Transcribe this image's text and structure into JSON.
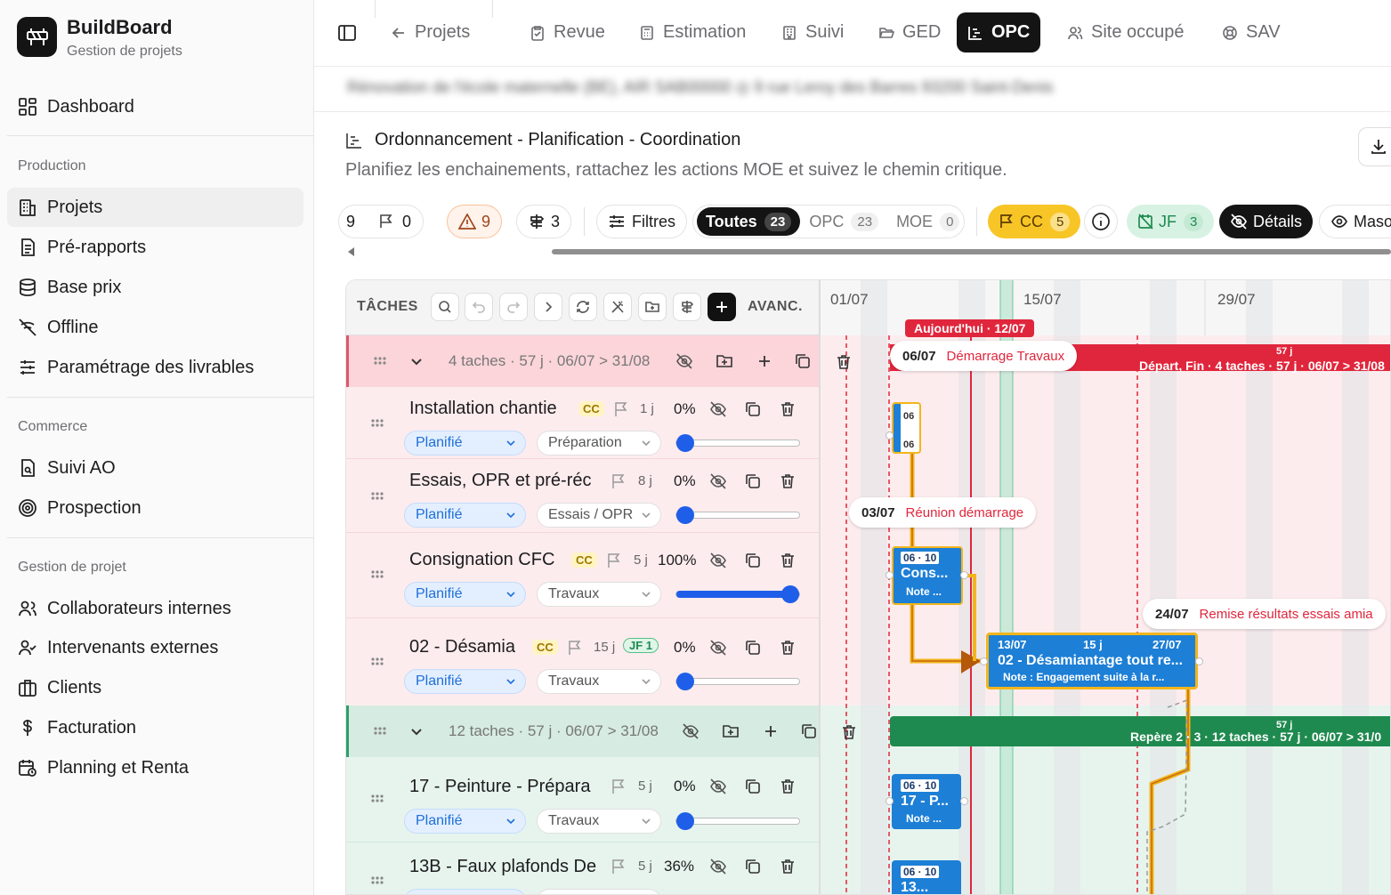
{
  "app": {
    "name": "BuildBoard",
    "subtitle": "Gestion de projets"
  },
  "sidebar": {
    "dashboard": "Dashboard",
    "sections": {
      "production": "Production",
      "commerce": "Commerce",
      "gestion": "Gestion de projet"
    },
    "items": {
      "projets": "Projets",
      "prerapports": "Pré-rapports",
      "baseprix": "Base prix",
      "offline": "Offline",
      "livrables": "Paramétrage des livrables",
      "suiviao": "Suivi AO",
      "prospection": "Prospection",
      "collab": "Collaborateurs internes",
      "intervenants": "Intervenants externes",
      "clients": "Clients",
      "facturation": "Facturation",
      "planning": "Planning et Renta"
    }
  },
  "tabs": {
    "projets": "Projets",
    "revue": "Revue",
    "estimation": "Estimation",
    "suivi": "Suivi",
    "ged": "GED",
    "opc": "OPC",
    "siteoccupe": "Site occupé",
    "sav": "SAV"
  },
  "project_blurred": "Rénovation de l'école maternelle (BE), AIR   SAB00000   ◎ 9 rue Leroy des Barres 93200 Saint-Denis",
  "section": {
    "title": "Ordonnancement - Planification - Coordination",
    "subtitle": "Planifiez les enchainements, rattachez les actions MOE et suivez le chemin critique."
  },
  "toolbar": {
    "count_partial": "9",
    "flags": "0",
    "warnings": "9",
    "signposts": "3",
    "filtres": "Filtres",
    "toutes": "Toutes",
    "toutes_count": "23",
    "opc": "OPC",
    "opc_count": "23",
    "moe": "MOE",
    "moe_count": "0",
    "cc": "CC",
    "cc_count": "5",
    "jf": "JF",
    "jf_count": "3",
    "details": "Détails",
    "masquer": "Maso"
  },
  "grid": {
    "col_taches": "TÂCHES",
    "col_avanc": "AVANC.",
    "dates": [
      "01/07",
      "15/07",
      "29/07"
    ]
  },
  "groups": [
    {
      "info": "4 taches · 57 j · 06/07 > 31/08",
      "bar_label": "Départ, Fin · 4 taches · 57 j · 06/07 > 31/08",
      "bar_dur": "57 j"
    },
    {
      "info": "12 taches · 57 j · 06/07 > 31/08",
      "bar_label": "Repère 2 · 3 · 12 taches · 57 j · 06/07 > 31/0",
      "bar_dur": "57 j"
    }
  ],
  "tasks": [
    {
      "name": "Installation chantie",
      "cc": "CC",
      "duration": "1 j",
      "progress_text": "0%",
      "progress": 0,
      "status": "Planifié",
      "phase": "Préparation"
    },
    {
      "name": "Essais, OPR et pré-réc",
      "duration": "8 j",
      "progress_text": "0%",
      "progress": 0,
      "status": "Planifié",
      "phase": "Essais / OPR"
    },
    {
      "name": "Consignation CFC",
      "cc": "CC",
      "duration": "5 j",
      "progress_text": "100%",
      "progress": 100,
      "status": "Planifié",
      "phase": "Travaux"
    },
    {
      "name": "02 - Désamia",
      "cc": "CC",
      "duration": "15 j",
      "jf": "JF 1",
      "progress_text": "0%",
      "progress": 0,
      "status": "Planifié",
      "phase": "Travaux"
    },
    {
      "name": "17 - Peinture - Prépara",
      "duration": "5 j",
      "progress_text": "0%",
      "progress": 0,
      "status": "Planifié",
      "phase": "Travaux"
    },
    {
      "name": "13B - Faux plafonds De",
      "duration": "5 j",
      "progress_text": "36%",
      "progress": 36
    }
  ],
  "gantt": {
    "today": "Aujourd'hui · 12/07",
    "milestones": [
      {
        "date": "06/07",
        "text": "Démarrage Travaux"
      },
      {
        "date": "03/07",
        "text": "Réunion démarrage"
      },
      {
        "date": "24/07",
        "text": "Remise résultats essais amia"
      }
    ],
    "bars": {
      "install": {
        "d1": "06",
        "d2": "06"
      },
      "cons": {
        "dates": "06 · 10",
        "name": "Cons...",
        "note": "Note ..."
      },
      "desam": {
        "start": "13/07",
        "dur": "15 j",
        "end": "27/07",
        "name": "02 - Désamiantage tout re...",
        "note": "Note : Engagement suite à la r..."
      },
      "peint": {
        "dates": "06 · 10",
        "name": "17 - P...",
        "note": "Note ..."
      },
      "fp": {
        "dates": "06 · 10",
        "name": "13..."
      }
    }
  },
  "colors": {
    "accent": "#141414",
    "critical": "#e0263c",
    "task_blue": "#1d7fd6",
    "critical_path": "#f2b51c",
    "group_green": "#1f8a4f"
  }
}
